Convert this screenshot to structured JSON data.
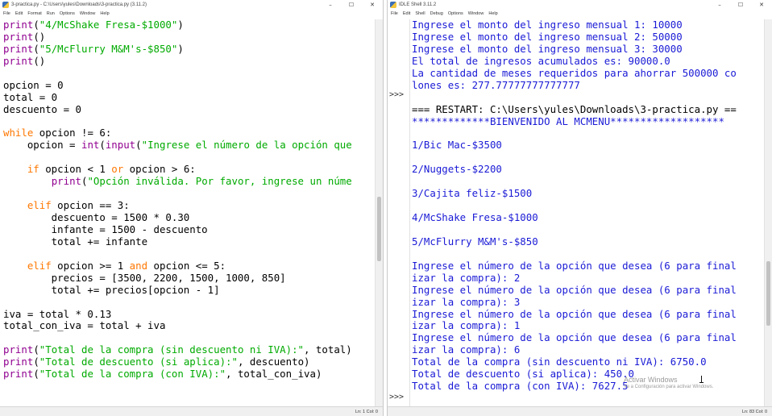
{
  "editor_window": {
    "title": "3-practica.py - C:\\Users\\yules\\Downloads\\3-practica.py (3.11.2)",
    "controls": {
      "minimize": "–",
      "maximize": "☐",
      "close": "✕"
    },
    "menu": [
      "File",
      "Edit",
      "Format",
      "Run",
      "Options",
      "Window",
      "Help"
    ],
    "code_lines": [
      [
        {
          "t": "print",
          "c": "bi"
        },
        {
          "t": "(",
          "c": ""
        },
        {
          "t": "\"4/McShake Fresa-$1000\"",
          "c": "str"
        },
        {
          "t": ")",
          "c": ""
        }
      ],
      [
        {
          "t": "print",
          "c": "bi"
        },
        {
          "t": "()",
          "c": ""
        }
      ],
      [
        {
          "t": "print",
          "c": "bi"
        },
        {
          "t": "(",
          "c": ""
        },
        {
          "t": "\"5/McFlurry M&M's-$850\"",
          "c": "str"
        },
        {
          "t": ")",
          "c": ""
        }
      ],
      [
        {
          "t": "print",
          "c": "bi"
        },
        {
          "t": "()",
          "c": ""
        }
      ],
      [],
      [
        {
          "t": "opcion = 0",
          "c": ""
        }
      ],
      [
        {
          "t": "total = 0",
          "c": ""
        }
      ],
      [
        {
          "t": "descuento = 0",
          "c": ""
        }
      ],
      [],
      [
        {
          "t": "while",
          "c": "kw"
        },
        {
          "t": " opcion != 6:",
          "c": ""
        }
      ],
      [
        {
          "t": "    opcion = ",
          "c": ""
        },
        {
          "t": "int",
          "c": "bi"
        },
        {
          "t": "(",
          "c": ""
        },
        {
          "t": "input",
          "c": "bi"
        },
        {
          "t": "(",
          "c": ""
        },
        {
          "t": "\"Ingrese el número de la opción que",
          "c": "str"
        }
      ],
      [],
      [
        {
          "t": "    ",
          "c": ""
        },
        {
          "t": "if",
          "c": "kw"
        },
        {
          "t": " opcion < 1 ",
          "c": ""
        },
        {
          "t": "or",
          "c": "kw"
        },
        {
          "t": " opcion > 6:",
          "c": ""
        }
      ],
      [
        {
          "t": "        ",
          "c": ""
        },
        {
          "t": "print",
          "c": "bi"
        },
        {
          "t": "(",
          "c": ""
        },
        {
          "t": "\"Opción inválida. Por favor, ingrese un núme",
          "c": "str"
        }
      ],
      [],
      [
        {
          "t": "    ",
          "c": ""
        },
        {
          "t": "elif",
          "c": "kw"
        },
        {
          "t": " opcion == 3:",
          "c": ""
        }
      ],
      [
        {
          "t": "        descuento = 1500 * 0.30",
          "c": ""
        }
      ],
      [
        {
          "t": "        infante = 1500 - descuento",
          "c": ""
        }
      ],
      [
        {
          "t": "        total += infante",
          "c": ""
        }
      ],
      [],
      [
        {
          "t": "    ",
          "c": ""
        },
        {
          "t": "elif",
          "c": "kw"
        },
        {
          "t": " opcion >= 1 ",
          "c": ""
        },
        {
          "t": "and",
          "c": "kw"
        },
        {
          "t": " opcion <= 5:",
          "c": ""
        }
      ],
      [
        {
          "t": "        precios = [3500, 2200, 1500, 1000, 850]",
          "c": ""
        }
      ],
      [
        {
          "t": "        total += precios[opcion - 1]",
          "c": ""
        }
      ],
      [],
      [
        {
          "t": "iva = total * 0.13",
          "c": ""
        }
      ],
      [
        {
          "t": "total_con_iva = total + iva",
          "c": ""
        }
      ],
      [],
      [
        {
          "t": "print",
          "c": "bi"
        },
        {
          "t": "(",
          "c": ""
        },
        {
          "t": "\"Total de la compra (sin descuento ni IVA):\"",
          "c": "str"
        },
        {
          "t": ", total)",
          "c": ""
        }
      ],
      [
        {
          "t": "print",
          "c": "bi"
        },
        {
          "t": "(",
          "c": ""
        },
        {
          "t": "\"Total de descuento (si aplica):\"",
          "c": "str"
        },
        {
          "t": ", descuento)",
          "c": ""
        }
      ],
      [
        {
          "t": "print",
          "c": "bi"
        },
        {
          "t": "(",
          "c": ""
        },
        {
          "t": "\"Total de la compra (con IVA):\"",
          "c": "str"
        },
        {
          "t": ", total_con_iva)",
          "c": ""
        }
      ]
    ],
    "status": "Ln: 1   Col: 0",
    "scroll_position": 0.55
  },
  "shell_window": {
    "title": "IDLE Shell 3.11.2",
    "controls": {
      "minimize": "–",
      "maximize": "☐",
      "close": "✕"
    },
    "menu": [
      "File",
      "Edit",
      "Shell",
      "Debug",
      "Options",
      "Window",
      "Help"
    ],
    "output_lines": [
      {
        "t": "Ingrese el monto del ingreso mensual 1: 10000",
        "s": "out"
      },
      {
        "t": "Ingrese el monto del ingreso mensual 2: 50000",
        "s": "out"
      },
      {
        "t": "Ingrese el monto del ingreso mensual 3: 30000",
        "s": "out"
      },
      {
        "t": "El total de ingresos acumulados es: 90000.0",
        "s": "out"
      },
      {
        "t": "La cantidad de meses requeridos para ahorrar 500000 co",
        "s": "out"
      },
      {
        "t": "lones es: 277.77777777777777",
        "s": "out"
      },
      {
        "t": "",
        "s": "out"
      },
      {
        "t": "=== RESTART: C:\\Users\\yules\\Downloads\\3-practica.py ==",
        "s": "restart"
      },
      {
        "t": "*************BIENVENIDO AL MCMENU*******************",
        "s": "out"
      },
      {
        "t": "",
        "s": "out"
      },
      {
        "t": "1/Bic Mac-$3500",
        "s": "out"
      },
      {
        "t": "",
        "s": "out"
      },
      {
        "t": "2/Nuggets-$2200",
        "s": "out"
      },
      {
        "t": "",
        "s": "out"
      },
      {
        "t": "3/Cajita feliz-$1500",
        "s": "out"
      },
      {
        "t": "",
        "s": "out"
      },
      {
        "t": "4/McShake Fresa-$1000",
        "s": "out"
      },
      {
        "t": "",
        "s": "out"
      },
      {
        "t": "5/McFlurry M&M's-$850",
        "s": "out"
      },
      {
        "t": "",
        "s": "out"
      },
      {
        "t": "Ingrese el número de la opción que desea (6 para final",
        "s": "out"
      },
      {
        "t": "izar la compra): 2",
        "s": "out"
      },
      {
        "t": "Ingrese el número de la opción que desea (6 para final",
        "s": "out"
      },
      {
        "t": "izar la compra): 3",
        "s": "out"
      },
      {
        "t": "Ingrese el número de la opción que desea (6 para final",
        "s": "out"
      },
      {
        "t": "izar la compra): 1",
        "s": "out"
      },
      {
        "t": "Ingrese el número de la opción que desea (6 para final",
        "s": "out"
      },
      {
        "t": "izar la compra): 6",
        "s": "out"
      },
      {
        "t": "Total de la compra (sin descuento ni IVA): 6750.0",
        "s": "out"
      },
      {
        "t": "Total de descuento (si aplica): 450.0",
        "s": "out"
      },
      {
        "t": "Total de la compra (con IVA): 7627.5",
        "s": "out"
      }
    ],
    "prompts": [
      ">>>",
      ">>>"
    ],
    "status": "Ln: 83   Col: 0",
    "scroll_position": 0.75
  },
  "watermark": {
    "line1": "Activar Windows",
    "line2": "Ve a Configuración para activar Windows."
  },
  "colors": {
    "keyword": "#ff7700",
    "builtin": "#900090",
    "string": "#00aa00",
    "shell_output": "#1a1ad6"
  }
}
